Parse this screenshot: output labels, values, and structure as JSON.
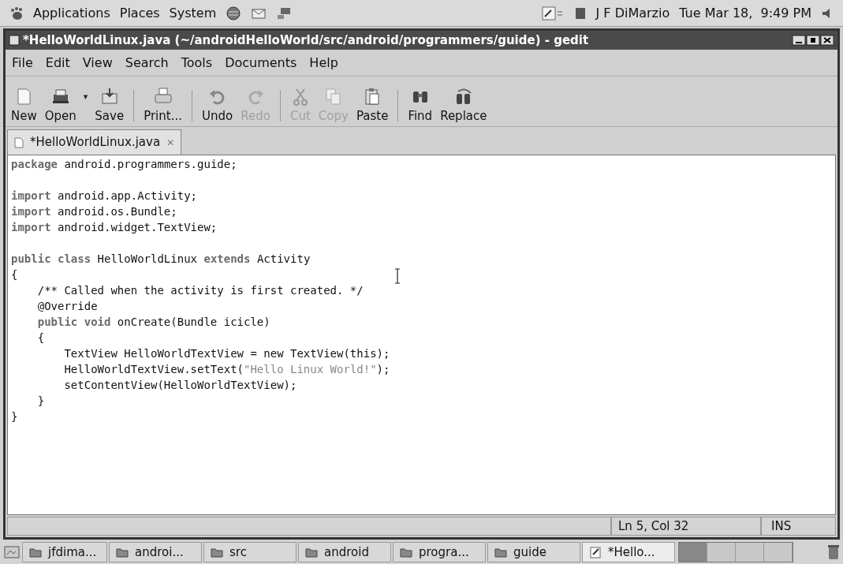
{
  "top_panel": {
    "menus": [
      "Applications",
      "Places",
      "System"
    ],
    "user": "J F DiMarzio",
    "clock": "Tue Mar 18,  9:49 PM"
  },
  "window": {
    "title": "*HelloWorldLinux.java (~/androidHelloWorld/src/android/programmers/guide) - gedit"
  },
  "menu_bar": [
    "File",
    "Edit",
    "View",
    "Search",
    "Tools",
    "Documents",
    "Help"
  ],
  "toolbar": [
    {
      "kind": "button",
      "label": "New",
      "disabled": false
    },
    {
      "kind": "button",
      "label": "Open",
      "disabled": false
    },
    {
      "kind": "dropdown",
      "label": "▾",
      "disabled": false
    },
    {
      "kind": "button",
      "label": "Save",
      "disabled": false
    },
    {
      "kind": "separator"
    },
    {
      "kind": "button",
      "label": "Print...",
      "disabled": false
    },
    {
      "kind": "separator"
    },
    {
      "kind": "button",
      "label": "Undo",
      "disabled": false
    },
    {
      "kind": "button",
      "label": "Redo",
      "disabled": true
    },
    {
      "kind": "separator"
    },
    {
      "kind": "button",
      "label": "Cut",
      "disabled": true
    },
    {
      "kind": "button",
      "label": "Copy",
      "disabled": true
    },
    {
      "kind": "button",
      "label": "Paste",
      "disabled": false
    },
    {
      "kind": "separator"
    },
    {
      "kind": "button",
      "label": "Find",
      "disabled": false
    },
    {
      "kind": "button",
      "label": "Replace",
      "disabled": false
    }
  ],
  "tabs": [
    {
      "label": "*HelloWorldLinux.java",
      "close": "✕",
      "selected": true
    }
  ],
  "editor": {
    "lines": [
      {
        "kind": "code",
        "segments": [
          {
            "kind": "keyword",
            "text": "package"
          },
          {
            "kind": "plain",
            "text": " android.programmers.guide;"
          }
        ]
      },
      {
        "kind": "blank"
      },
      {
        "kind": "code",
        "segments": [
          {
            "kind": "keyword",
            "text": "import"
          },
          {
            "kind": "plain",
            "text": " android.app.Activity;"
          }
        ]
      },
      {
        "kind": "code",
        "segments": [
          {
            "kind": "keyword",
            "text": "import"
          },
          {
            "kind": "plain",
            "text": " android.os.Bundle;"
          }
        ]
      },
      {
        "kind": "code",
        "segments": [
          {
            "kind": "keyword",
            "text": "import"
          },
          {
            "kind": "plain",
            "text": " android.widget.TextView;"
          }
        ]
      },
      {
        "kind": "blank"
      },
      {
        "kind": "code",
        "segments": [
          {
            "kind": "keyword",
            "text": "public class"
          },
          {
            "kind": "plain",
            "text": " HelloWorldLinux "
          },
          {
            "kind": "keyword",
            "text": "extends"
          },
          {
            "kind": "plain",
            "text": " Activity"
          }
        ]
      },
      {
        "kind": "code",
        "segments": [
          {
            "kind": "plain",
            "text": "{"
          }
        ]
      },
      {
        "kind": "code",
        "segments": [
          {
            "kind": "plain",
            "text": "    /** Called when the activity is first created. */"
          }
        ]
      },
      {
        "kind": "code",
        "segments": [
          {
            "kind": "plain",
            "text": "    @Override"
          }
        ]
      },
      {
        "kind": "code",
        "segments": [
          {
            "kind": "keyword",
            "text": "    public void"
          },
          {
            "kind": "plain",
            "text": " onCreate(Bundle icicle)"
          }
        ]
      },
      {
        "kind": "code",
        "segments": [
          {
            "kind": "plain",
            "text": "    {"
          }
        ]
      },
      {
        "kind": "code",
        "segments": [
          {
            "kind": "plain",
            "text": "        TextView HelloWorldTextView = new TextView(this);"
          }
        ]
      },
      {
        "kind": "code",
        "segments": [
          {
            "kind": "plain",
            "text": "        HelloWorldTextView.setText("
          },
          {
            "kind": "string",
            "text": "\"Hello Linux World!\""
          },
          {
            "kind": "plain",
            "text": ");"
          }
        ]
      },
      {
        "kind": "code",
        "segments": [
          {
            "kind": "plain",
            "text": "        setContentView(HelloWorldTextView);"
          }
        ]
      },
      {
        "kind": "code",
        "segments": [
          {
            "kind": "plain",
            "text": "    }"
          }
        ]
      },
      {
        "kind": "code",
        "segments": [
          {
            "kind": "plain",
            "text": "}"
          }
        ]
      }
    ]
  },
  "status_bar": {
    "position": "Ln 5, Col 32",
    "mode": "INS"
  },
  "taskbar": {
    "items": [
      {
        "kind": "folder",
        "label": "jfdima...",
        "selected": false
      },
      {
        "kind": "folder",
        "label": "androi...",
        "selected": false
      },
      {
        "kind": "folder",
        "label": "src",
        "selected": false
      },
      {
        "kind": "folder",
        "label": "android",
        "selected": false
      },
      {
        "kind": "folder",
        "label": "progra...",
        "selected": false
      },
      {
        "kind": "folder",
        "label": "guide",
        "selected": false
      },
      {
        "kind": "editor",
        "label": "*Hello...",
        "selected": true
      }
    ],
    "workspaces": [
      {
        "selected": true
      },
      {
        "selected": false
      },
      {
        "selected": false
      },
      {
        "selected": false
      }
    ]
  }
}
